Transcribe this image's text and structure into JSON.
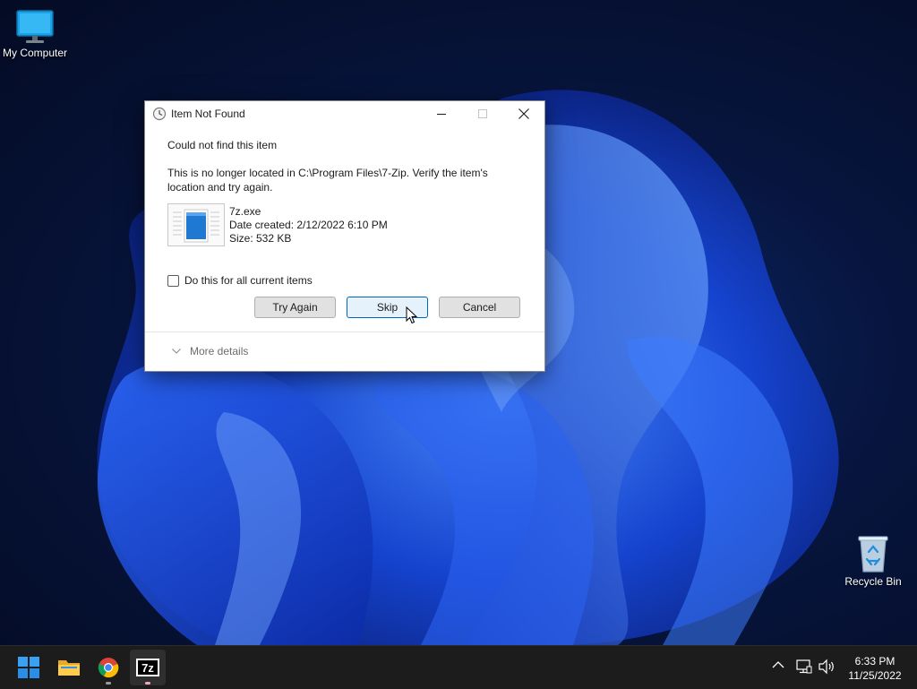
{
  "desktop": {
    "icons": [
      {
        "label": "My Computer",
        "icon": "monitor-icon"
      },
      {
        "label": "Recycle Bin",
        "icon": "recycle-bin-icon"
      }
    ]
  },
  "dialog": {
    "title": "Item Not Found",
    "title_icon": "clock-icon",
    "heading": "Could not find this item",
    "message": "This is no longer located in C:\\Program Files\\7-Zip. Verify the item's location and try again.",
    "file": {
      "name": "7z.exe",
      "date_created": "Date created: 2/12/2022 6:10 PM",
      "size": "Size: 532 KB"
    },
    "checkbox_label": "Do this for all current items",
    "checkbox_checked": false,
    "buttons": {
      "try_again": "Try Again",
      "skip": "Skip",
      "cancel": "Cancel"
    },
    "more_details": "More details"
  },
  "taskbar": {
    "apps": [
      {
        "name": "start",
        "icon": "windows-logo-icon"
      },
      {
        "name": "file-explorer",
        "icon": "folder-icon"
      },
      {
        "name": "chrome",
        "icon": "chrome-icon"
      },
      {
        "name": "7-zip",
        "icon": "7z-icon",
        "label": "7z"
      }
    ],
    "clock": {
      "time": "6:33 PM",
      "date": "11/25/2022"
    }
  },
  "colors": {
    "accent": "#0067c0",
    "dialog_bg": "#ffffff",
    "taskbar_bg": "#1c1c1c"
  }
}
